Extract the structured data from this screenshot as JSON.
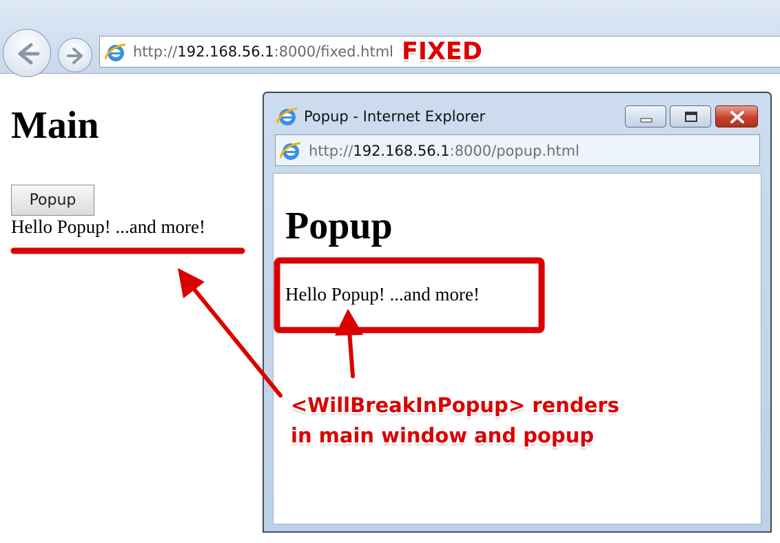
{
  "browser": {
    "url_prefix": "http://",
    "url_host": "192.168.56.1",
    "url_suffix": ":8000/fixed.html"
  },
  "annotation_label": "FIXED",
  "main_page": {
    "title": "Main",
    "button_label": "Popup",
    "text": "Hello Popup! ...and more!"
  },
  "popup_window": {
    "title": "Popup - Internet Explorer",
    "url_prefix": "http://",
    "url_host": "192.168.56.1",
    "url_suffix": ":8000/popup.html",
    "heading": "Popup",
    "text": "Hello Popup! ...and more!"
  },
  "callout": {
    "line1": "<WillBreakInPopup> renders",
    "line2": "in main window and popup"
  },
  "colors": {
    "annotation_red": "#d90000"
  },
  "icons": [
    "back-arrow-icon",
    "forward-arrow-icon",
    "ie-icon",
    "minimize-icon",
    "maximize-icon",
    "close-icon"
  ]
}
